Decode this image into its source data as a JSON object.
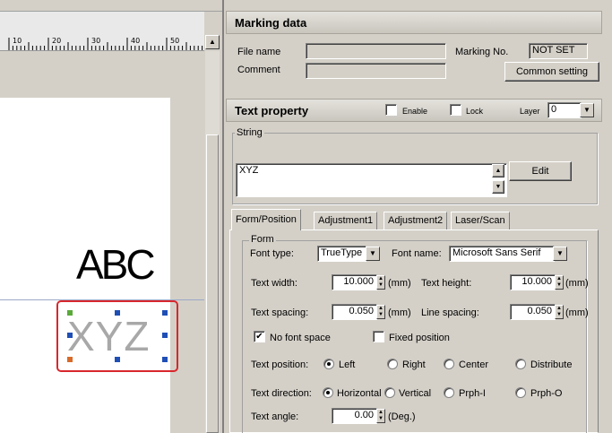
{
  "ruler": {
    "labels": [
      "10",
      "20",
      "30",
      "40",
      "50"
    ]
  },
  "canvas": {
    "abc_text": "ABC",
    "xyz_text": "XYZ"
  },
  "marking_data": {
    "title": "Marking data",
    "file_name_label": "File name",
    "file_name_value": "",
    "marking_no_label": "Marking No.",
    "marking_no_value": "NOT SET",
    "comment_label": "Comment",
    "comment_value": "",
    "common_setting_label": "Common setting"
  },
  "text_property": {
    "title": "Text property",
    "enable_label": "Enable",
    "enable_checked": false,
    "lock_label": "Lock",
    "lock_checked": false,
    "layer_label": "Layer",
    "layer_value": "0",
    "string_group": "String",
    "string_value": "XYZ",
    "edit_label": "Edit"
  },
  "tabs": [
    {
      "label": "Form/Position",
      "active": true
    },
    {
      "label": "Adjustment1",
      "active": false
    },
    {
      "label": "Adjustment2",
      "active": false
    },
    {
      "label": "Laser/Scan",
      "active": false
    }
  ],
  "form": {
    "group_title": "Form",
    "font_type_label": "Font type:",
    "font_type_value": "TrueType",
    "font_name_label": "Font name:",
    "font_name_value": "Microsoft Sans Serif",
    "text_width_label": "Text width:",
    "text_width_value": "10.000",
    "text_height_label": "Text height:",
    "text_height_value": "10.000",
    "text_spacing_label": "Text spacing:",
    "text_spacing_value": "0.050",
    "line_spacing_label": "Line spacing:",
    "line_spacing_value": "0.050",
    "unit_mm": "(mm)",
    "no_font_space_label": "No font space",
    "no_font_space_checked": true,
    "fixed_position_label": "Fixed position",
    "fixed_position_checked": false,
    "text_position_label": "Text position:",
    "text_position_options": [
      "Left",
      "Right",
      "Center",
      "Distribute"
    ],
    "text_position_selected": "Left",
    "text_direction_label": "Text direction:",
    "text_direction_options": [
      "Horizontal",
      "Vertical",
      "Prph-I",
      "Prph-O"
    ],
    "text_direction_selected": "Horizontal",
    "text_angle_label": "Text angle:",
    "text_angle_value": "0.00",
    "unit_deg": "(Deg.)"
  },
  "colors": {
    "selection_frame": "#d8272d",
    "handle": "#1f4fb5",
    "guide_line": "#9aa8c8"
  }
}
